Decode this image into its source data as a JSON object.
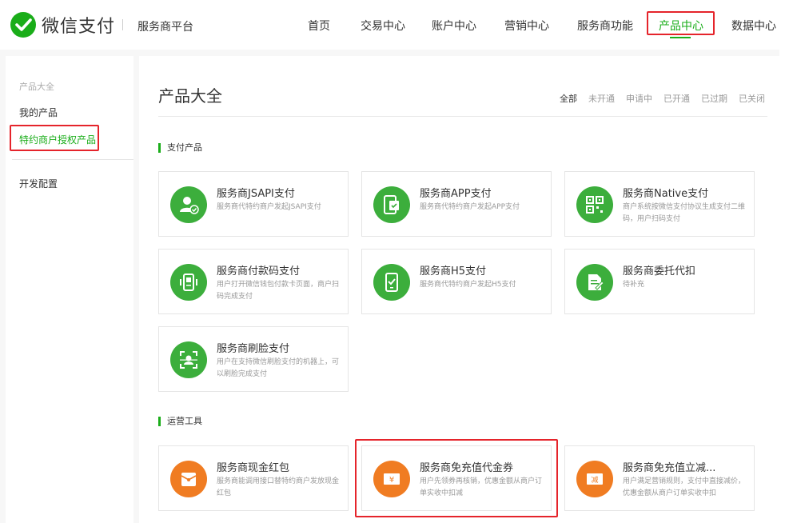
{
  "header": {
    "logo_text": "微信支付",
    "platform": "服务商平台",
    "nav": [
      {
        "label": "首页"
      },
      {
        "label": "交易中心"
      },
      {
        "label": "账户中心"
      },
      {
        "label": "营销中心"
      },
      {
        "label": "服务商功能"
      },
      {
        "label": "产品中心",
        "active": true
      },
      {
        "label": "数据中心"
      }
    ]
  },
  "sidebar": {
    "title": "产品大全",
    "items": [
      {
        "label": "我的产品"
      },
      {
        "label": "特约商户授权产品",
        "active": true
      },
      {
        "label": "开发配置"
      }
    ]
  },
  "main": {
    "title": "产品大全",
    "filters": [
      {
        "label": "全部",
        "active": true
      },
      {
        "label": "未开通"
      },
      {
        "label": "申请中"
      },
      {
        "label": "已开通"
      },
      {
        "label": "已过期"
      },
      {
        "label": "已关闭"
      }
    ],
    "sections": [
      {
        "label": "支付产品",
        "cards": [
          {
            "name": "服务商JSAPI支付",
            "desc": "服务商代特约商户发起JSAPI支付",
            "icon": "user-check-icon",
            "color": "#3cae3c"
          },
          {
            "name": "服务商APP支付",
            "desc": "服务商代特约商户发起APP支付",
            "icon": "mobile-app-icon",
            "color": "#3cae3c"
          },
          {
            "name": "服务商Native支付",
            "desc": "商户系统按微信支付协议生成支付二维码，用户扫码支付",
            "icon": "qrcode-icon",
            "color": "#3cae3c"
          },
          {
            "name": "服务商付款码支付",
            "desc": "用户打开微信钱包付款卡页面，商户扫码完成支付",
            "icon": "barcode-scanner-icon",
            "color": "#3cae3c"
          },
          {
            "name": "服务商H5支付",
            "desc": "服务商代特约商户发起H5支付",
            "icon": "mobile-h5-icon",
            "color": "#3cae3c"
          },
          {
            "name": "服务商委托代扣",
            "desc": "待补充",
            "icon": "document-edit-icon",
            "color": "#3cae3c"
          },
          {
            "name": "服务商刷脸支付",
            "desc": "用户在支持微信刷脸支付的机器上，可以刷脸完成支付",
            "icon": "face-scan-icon",
            "color": "#3cae3c"
          }
        ]
      },
      {
        "label": "运营工具",
        "cards": [
          {
            "name": "服务商现金红包",
            "desc": "服务商能调用接口替特约商户发放现金红包",
            "icon": "red-packet-icon",
            "color": "#f07c22"
          },
          {
            "name": "服务商免充值代金券",
            "desc": "用户先领券再核销，优惠金额从商户订单实收中扣减",
            "icon": "coupon-yen-icon",
            "color": "#f07c22"
          },
          {
            "name": "服务商免充值立减...",
            "desc": "用户满足营销规则，支付中直接减价，优惠金额从商户订单实收中扣",
            "icon": "discount-icon",
            "color": "#f07c22"
          }
        ]
      }
    ]
  },
  "colors": {
    "accent": "#1aad19",
    "highlight_box": "#e5242b",
    "icon_green": "#3cae3c",
    "icon_orange": "#f07c22"
  }
}
